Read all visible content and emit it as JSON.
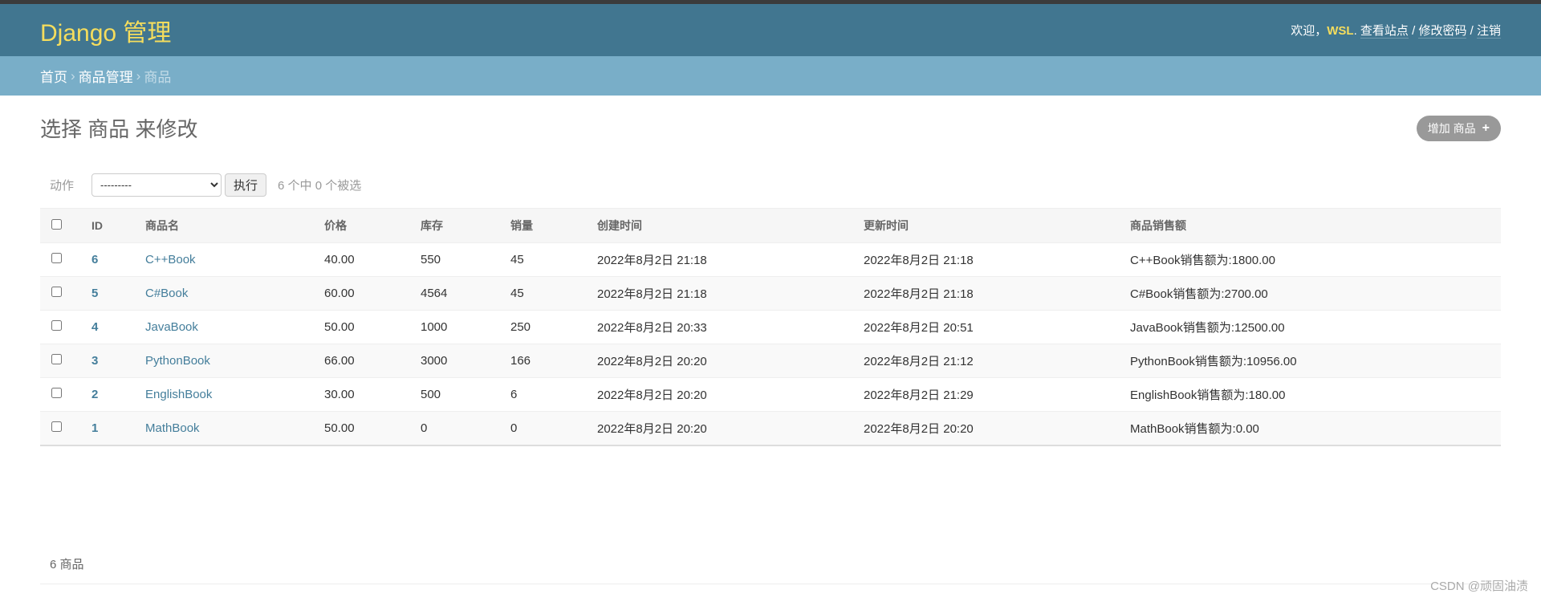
{
  "header": {
    "brand": "Django 管理",
    "welcome": "欢迎，",
    "username": "WSL",
    "view_site": "查看站点",
    "change_password": "修改密码",
    "logout": "注销",
    "sep": "/"
  },
  "breadcrumbs": {
    "home": "首页",
    "app": "商品管理",
    "current": "商品",
    "sep": "›"
  },
  "page": {
    "title": "选择 商品 来修改",
    "add_label": "增加 商品",
    "add_icon": "+"
  },
  "actions": {
    "label": "动作",
    "select_value": "---------",
    "go_label": "执行",
    "counter": "6 个中 0 个被选"
  },
  "table": {
    "columns": [
      "ID",
      "商品名",
      "价格",
      "库存",
      "销量",
      "创建时间",
      "更新时间",
      "商品销售额"
    ],
    "rows": [
      {
        "id": "6",
        "name": "C++Book",
        "price": "40.00",
        "stock": "550",
        "sales": "45",
        "created": "2022年8月2日 21:18",
        "updated": "2022年8月2日 21:18",
        "revenue": "C++Book销售额为:1800.00"
      },
      {
        "id": "5",
        "name": "C#Book",
        "price": "60.00",
        "stock": "4564",
        "sales": "45",
        "created": "2022年8月2日 21:18",
        "updated": "2022年8月2日 21:18",
        "revenue": "C#Book销售额为:2700.00"
      },
      {
        "id": "4",
        "name": "JavaBook",
        "price": "50.00",
        "stock": "1000",
        "sales": "250",
        "created": "2022年8月2日 20:33",
        "updated": "2022年8月2日 20:51",
        "revenue": "JavaBook销售额为:12500.00"
      },
      {
        "id": "3",
        "name": "PythonBook",
        "price": "66.00",
        "stock": "3000",
        "sales": "166",
        "created": "2022年8月2日 20:20",
        "updated": "2022年8月2日 21:12",
        "revenue": "PythonBook销售额为:10956.00"
      },
      {
        "id": "2",
        "name": "EnglishBook",
        "price": "30.00",
        "stock": "500",
        "sales": "6",
        "created": "2022年8月2日 20:20",
        "updated": "2022年8月2日 21:29",
        "revenue": "EnglishBook销售额为:180.00"
      },
      {
        "id": "1",
        "name": "MathBook",
        "price": "50.00",
        "stock": "0",
        "sales": "0",
        "created": "2022年8月2日 20:20",
        "updated": "2022年8月2日 20:20",
        "revenue": "MathBook销售额为:0.00"
      }
    ]
  },
  "paginator": {
    "count_text": "6 商品"
  },
  "watermark": "CSDN @顽固油渍",
  "colors": {
    "header_bg": "#417690",
    "brand": "#f5dd5d",
    "breadcrumbs_bg": "#79aec8",
    "link": "#447e9b",
    "add_button_bg": "#999999"
  }
}
